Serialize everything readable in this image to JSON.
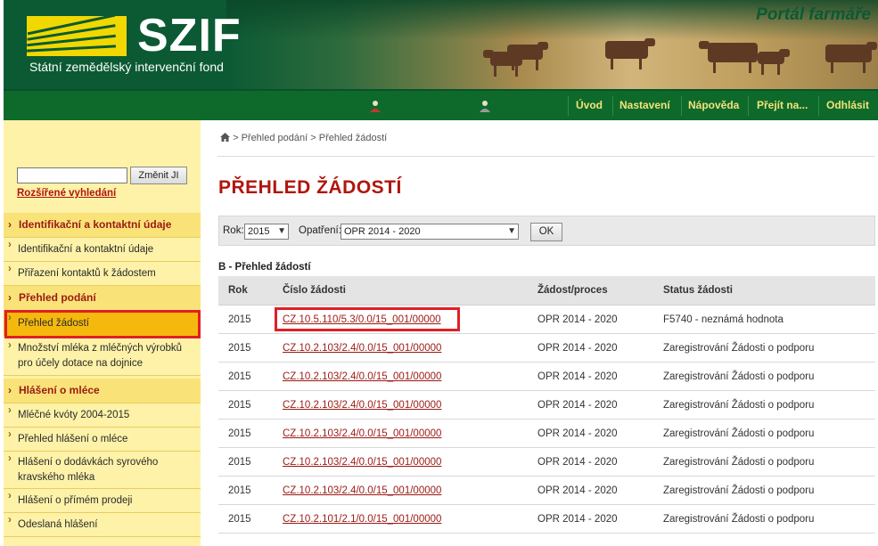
{
  "header": {
    "logo_text": "SZIF",
    "logo_subtitle": "Státní zemědělský intervenční fond",
    "portal_title": "Portál farmáře"
  },
  "navbar": {
    "items": [
      "Úvod",
      "Nastavení",
      "Nápověda",
      "Přejít na...",
      "Odhlásit"
    ],
    "icons": [
      "user-icon",
      "user-settings-icon"
    ]
  },
  "sidebar": {
    "search_placeholder": "",
    "search_button": "Změnit JI",
    "advanced_search": "Rozšířené vyhledání",
    "sections": [
      {
        "title": "Identifikační a kontaktní údaje",
        "items": [
          "Identifikační a kontaktní údaje",
          "Přiřazení kontaktů k žádostem"
        ]
      },
      {
        "title": "Přehled podání",
        "items": [
          "Přehled žádostí",
          "Množství mléka z mléčných výrobků pro účely dotace na dojnice"
        ]
      },
      {
        "title": "Hlášení o mléce",
        "items": [
          "Mléčné kvóty 2004-2015",
          "Přehled hlášení o mléce",
          "Hlášení o dodávkách syrového kravského mléka",
          "Hlášení o přímém prodeji",
          "Odeslaná hlášení"
        ]
      }
    ],
    "active_item": "Přehled žádostí",
    "active_color": "#f5b90d",
    "highlight_color": "#e01f26"
  },
  "breadcrumb": {
    "home_icon": "home-icon",
    "separator": ">",
    "link": "Přehled podání",
    "current": "Přehled žádostí"
  },
  "page_title": "PŘEHLED ŽÁDOSTÍ",
  "filter": {
    "year_label": "Rok:",
    "year_value": "2015",
    "measure_label": "Opatření:",
    "measure_value": "OPR 2014 - 2020",
    "ok_label": "OK"
  },
  "table": {
    "section_title": "B - Přehled žádostí",
    "columns": [
      "Rok",
      "Číslo žádosti",
      "Žádost/proces",
      "Status žádosti"
    ],
    "rows": [
      [
        "2015",
        "CZ.10.5.110/5.3/0.0/15_001/00000",
        "OPR 2014 - 2020",
        "F5740 - neznámá hodnota"
      ],
      [
        "2015",
        "CZ.10.2.103/2.4/0.0/15_001/00000",
        "OPR 2014 - 2020",
        "Zaregistrování Žádosti o podporu"
      ],
      [
        "2015",
        "CZ.10.2.103/2.4/0.0/15_001/00000",
        "OPR 2014 - 2020",
        "Zaregistrování Žádosti o podporu"
      ],
      [
        "2015",
        "CZ.10.2.103/2.4/0.0/15_001/00000",
        "OPR 2014 - 2020",
        "Zaregistrování Žádosti o podporu"
      ],
      [
        "2015",
        "CZ.10.2.103/2.4/0.0/15_001/00000",
        "OPR 2014 - 2020",
        "Zaregistrování Žádosti o podporu"
      ],
      [
        "2015",
        "CZ.10.2.103/2.4/0.0/15_001/00000",
        "OPR 2014 - 2020",
        "Zaregistrování Žádosti o podporu"
      ],
      [
        "2015",
        "CZ.10.2.103/2.4/0.0/15_001/00000",
        "OPR 2014 - 2020",
        "Zaregistrování Žádosti o podporu"
      ],
      [
        "2015",
        "CZ.10.2.101/2.1/0.0/15_001/00000",
        "OPR 2014 - 2020",
        "Zaregistrování Žádosti o podporu"
      ]
    ]
  }
}
